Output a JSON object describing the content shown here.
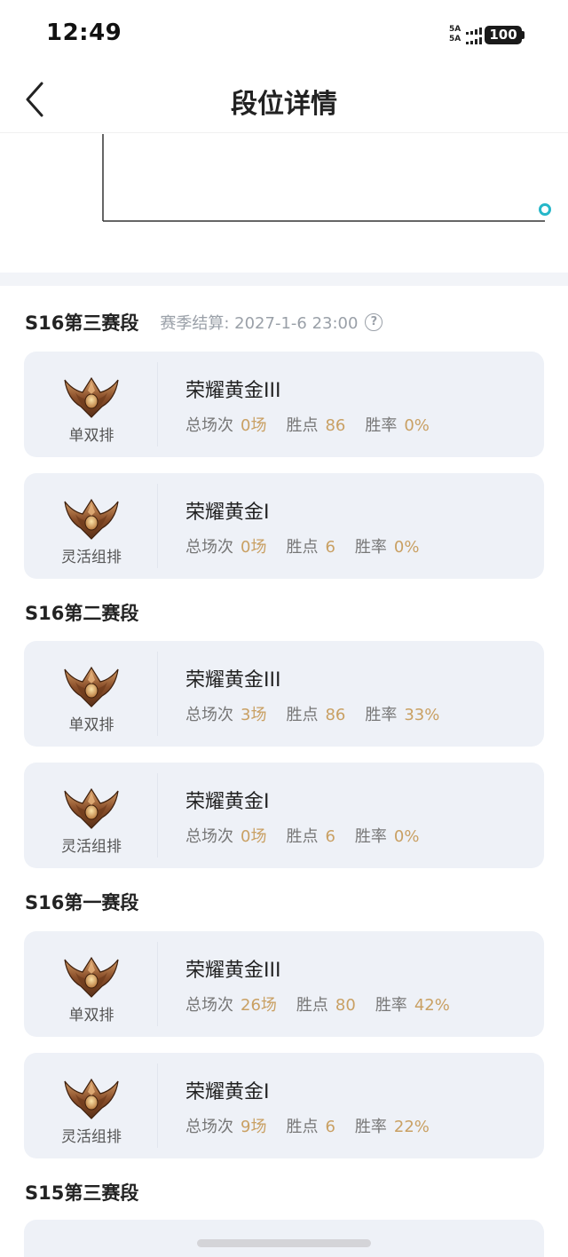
{
  "status_bar": {
    "time": "12:49",
    "signal_labels": [
      "5A",
      "5A"
    ],
    "battery": "100"
  },
  "nav": {
    "title": "段位详情",
    "back_icon": "chevron-left-icon"
  },
  "chart": {
    "accent_color": "#26b7c9",
    "axis_color": "#333333"
  },
  "seasons": [
    {
      "title": "S16第三赛段",
      "settlement": "赛季结算: 2027-1-6 23:00",
      "help_glyph": "?",
      "cards": [
        {
          "queue": "单双排",
          "tier": "荣耀黄金III",
          "games_label": "总场次",
          "games": "0场",
          "lp_label": "胜点",
          "lp": "86",
          "wr_label": "胜率",
          "wr": "0%"
        },
        {
          "queue": "灵活组排",
          "tier": "荣耀黄金I",
          "games_label": "总场次",
          "games": "0场",
          "lp_label": "胜点",
          "lp": "6",
          "wr_label": "胜率",
          "wr": "0%"
        }
      ]
    },
    {
      "title": "S16第二赛段",
      "cards": [
        {
          "queue": "单双排",
          "tier": "荣耀黄金III",
          "games_label": "总场次",
          "games": "3场",
          "lp_label": "胜点",
          "lp": "86",
          "wr_label": "胜率",
          "wr": "33%"
        },
        {
          "queue": "灵活组排",
          "tier": "荣耀黄金I",
          "games_label": "总场次",
          "games": "0场",
          "lp_label": "胜点",
          "lp": "6",
          "wr_label": "胜率",
          "wr": "0%"
        }
      ]
    },
    {
      "title": "S16第一赛段",
      "cards": [
        {
          "queue": "单双排",
          "tier": "荣耀黄金III",
          "games_label": "总场次",
          "games": "26场",
          "lp_label": "胜点",
          "lp": "80",
          "wr_label": "胜率",
          "wr": "42%"
        },
        {
          "queue": "灵活组排",
          "tier": "荣耀黄金I",
          "games_label": "总场次",
          "games": "9场",
          "lp_label": "胜点",
          "lp": "6",
          "wr_label": "胜率",
          "wr": "22%"
        }
      ]
    },
    {
      "title": "S15第三赛段",
      "cards": []
    }
  ],
  "colors": {
    "value_gold": "#c9a063",
    "card_bg": "#eef1f7",
    "settle_gray": "#9aa0a8"
  }
}
